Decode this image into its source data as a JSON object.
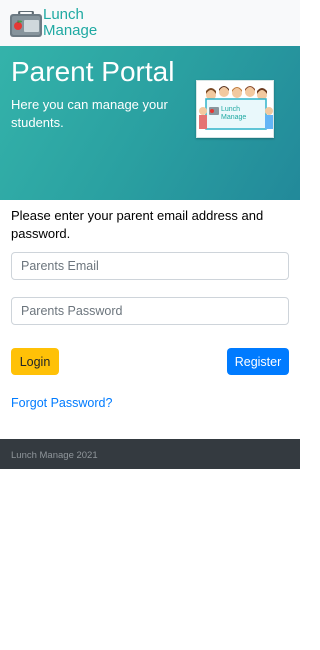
{
  "navbar": {
    "brand_line1": "Lunch",
    "brand_line2": "Manage",
    "logo_icon": "lunchbox-icon"
  },
  "hero": {
    "title": "Parent Portal",
    "subtitle": "Here you can manage your students.",
    "image": {
      "icon": "children-with-lunch-manage-sign-illustration",
      "sign_line1": "Lunch",
      "sign_line2": "Manage"
    }
  },
  "login": {
    "instructions": "Please enter your parent email address and password.",
    "email_placeholder": "Parents Email",
    "email_value": "",
    "password_placeholder": "Parents Password",
    "password_value": "",
    "login_label": "Login",
    "register_label": "Register",
    "forgot_label": "Forgot Password?"
  },
  "footer": {
    "text": "Lunch Manage 2021"
  },
  "colors": {
    "brand_teal": "#1fa9a2",
    "hero_gradient_start": "#34b3aa",
    "hero_gradient_end": "#22899a",
    "login_button": "#ffc107",
    "register_button": "#007bff",
    "link": "#007bff",
    "footer_bg": "#343a40"
  }
}
